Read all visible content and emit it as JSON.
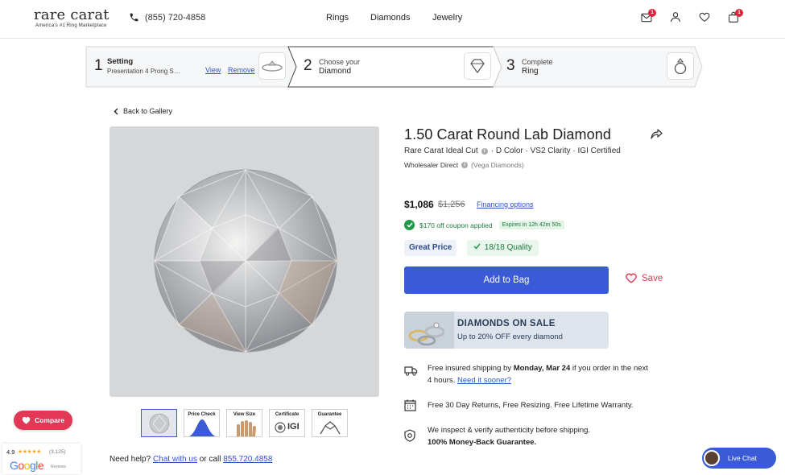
{
  "header": {
    "logo": "rare carat",
    "tagline": "America's #1 Ring Marketplace",
    "phone": "(855) 720-4858",
    "nav": [
      "Rings",
      "Diamonds",
      "Jewelry"
    ],
    "mail_badge": "1",
    "cart_badge": "1"
  },
  "steps": [
    {
      "num": "1",
      "title": "Setting",
      "sub": "Presentation 4 Prong S…",
      "view": "View",
      "remove": "Remove"
    },
    {
      "num": "2",
      "title": "Choose your",
      "sub": "Diamond"
    },
    {
      "num": "3",
      "title": "Complete",
      "sub": "Ring"
    }
  ],
  "back_label": "Back to Gallery",
  "thumbnails": [
    "",
    "Price Check",
    "View Size",
    "Certificate",
    "Guarantee"
  ],
  "certificate_mark": "IGI",
  "help": {
    "prefix": "Need help?",
    "chat": "Chat with us",
    "mid": "or call",
    "phone": "855.720.4858"
  },
  "compare_label": "Compare",
  "google": {
    "rating": "4.9",
    "stars": "★★★★★",
    "count": "(3,125)",
    "word": "Google",
    "reviews": "Reviews"
  },
  "product": {
    "title": "1.50 Carat Round Lab Diamond",
    "cut": "Rare Carat Ideal Cut",
    "specs_rest": "· D Color · VS2 Clarity · IGI Certified",
    "wholesale": "Wholesaler Direct",
    "vendor": "(Vega Diamonds)",
    "price": "$1,086",
    "old_price": "$1,256",
    "financing": "Financing options",
    "coupon": "$170 off coupon applied",
    "expires": "Expires in 12h 42m 50s",
    "great_price": "Great Price",
    "quality": "18/18 Quality",
    "add_to_bag": "Add to Bag",
    "save": "Save"
  },
  "sale": {
    "title": "DIAMONDS ON SALE",
    "sub": "Up to 20% OFF every diamond"
  },
  "features": {
    "ship_pre": "Free insured shipping by",
    "ship_date": "Monday, Mar 24",
    "ship_post": "if you order in the next",
    "ship_line2": "4 hours.",
    "ship_link": "Need it sooner?",
    "returns": "Free 30 Day Returns, Free Resizing. Free Lifetime Warranty.",
    "inspect": "We inspect & verify authenticity before shipping.",
    "guarantee": "100% Money-Back Guarantee."
  },
  "live_chat": "Live Chat",
  "colors": {
    "accent": "#3b5bd6",
    "link": "#2d55c8",
    "save": "#e03855",
    "success": "#1f9a4a"
  }
}
